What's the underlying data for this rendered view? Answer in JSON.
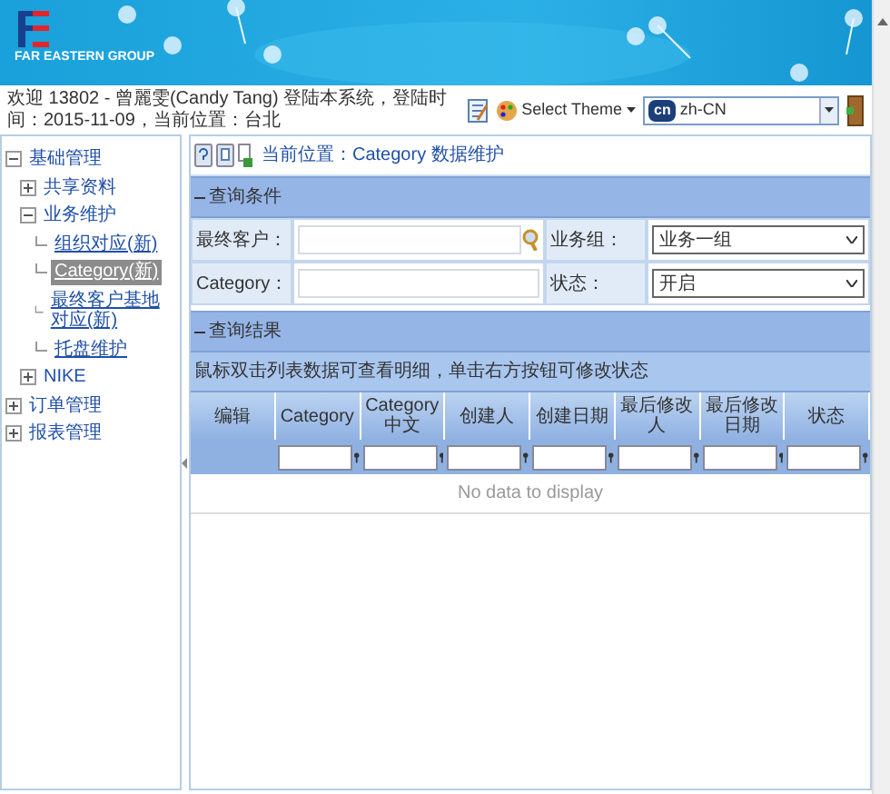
{
  "header": {
    "logo_text": "FAR EASTERN GROUP",
    "welcome": "欢迎 13802 - 曾麗雯(Candy Tang) 登陆本系统，登陆时间：2015-11-09，当前位置：台北",
    "theme_label": "Select Theme",
    "language": {
      "badge": "cn",
      "value": "zh-CN"
    }
  },
  "sidebar": {
    "items": [
      {
        "label": "基础管理",
        "expanded": true,
        "selected": false,
        "children": [
          {
            "label": "共享资料",
            "expanded": false,
            "selected": false
          },
          {
            "label": "业务维护",
            "expanded": true,
            "selected": false,
            "children": [
              {
                "label": "组织对应(新)",
                "selected": false
              },
              {
                "label": "Category(新)",
                "selected": true
              },
              {
                "label": "最终客户基地对应(新)",
                "selected": false
              },
              {
                "label": "托盘维护",
                "selected": false
              }
            ]
          },
          {
            "label": "NIKE",
            "expanded": false,
            "selected": false
          }
        ]
      },
      {
        "label": "订单管理",
        "expanded": false,
        "selected": false
      },
      {
        "label": "报表管理",
        "expanded": false,
        "selected": false
      }
    ]
  },
  "breadcrumb": "当前位置：Category 数据维护",
  "query": {
    "title": "查询条件",
    "expanded": true,
    "fields": [
      {
        "label": "最终客户：",
        "kind": "search"
      },
      {
        "label": "业务组：",
        "kind": "select",
        "value": "业务一组"
      },
      {
        "label": "Category：",
        "kind": "text"
      },
      {
        "label": "状态：",
        "kind": "select",
        "value": "开启"
      }
    ]
  },
  "results": {
    "title": "查询结果",
    "expanded": true,
    "note": "鼠标双击列表数据可查看明细，单击右方按钮可修改状态",
    "columns": [
      "编辑",
      "Category",
      "Category中文",
      "创建人",
      "创建日期",
      "最后修改人",
      "最后修改日期",
      "状态"
    ],
    "empty_text": "No data to display"
  }
}
